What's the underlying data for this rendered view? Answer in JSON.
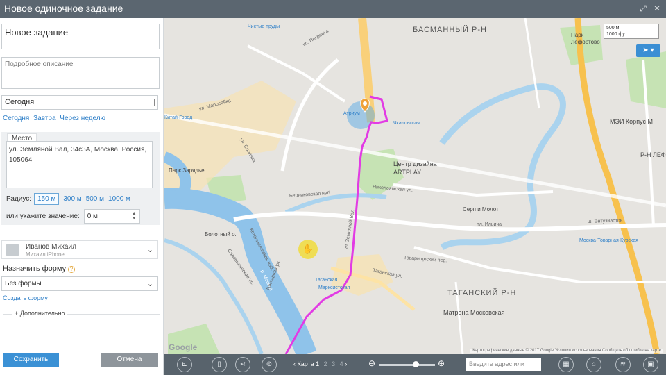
{
  "window": {
    "title": "Новое одиночное задание"
  },
  "form": {
    "title_value": "Новое задание",
    "description_placeholder": "Подробное описание",
    "date_value": "Сегодня",
    "date_links": [
      "Сегодня",
      "Завтра",
      "Через неделю"
    ],
    "place_legend": "Место",
    "address_value": "ул. Земляной Вал, 34с3А, Москва, Россия, 105064",
    "radius_label": "Радиус:",
    "radius_options": [
      "150 м",
      "300 м",
      "500 м",
      "1000 м"
    ],
    "radius_selected": "150 м",
    "or_label": "или укажите значение:",
    "or_value": "0 м",
    "user_name": "Иванов Михаил",
    "user_device": "Михаил iPhone",
    "assign_form_label": "Назначить форму",
    "form_select_value": "Без формы",
    "create_form_link": "Создать форму",
    "more_label": "Дополнительно",
    "save_label": "Сохранить",
    "cancel_label": "Отмена"
  },
  "map": {
    "districts": [
      "БАСМАННЫЙ Р-Н",
      "ТАГАНСКИЙ Р-Н"
    ],
    "places": {
      "artplay": "Центр дизайна ARTPLAY",
      "chkalovskaya": "Чкаловская",
      "atrium": "Атриум",
      "serp": "Серп и Молот",
      "mei": "МЭИ Корпус М",
      "park": "Парк Лефортово",
      "bolotny": "Болотный о.",
      "taganskaya": "Таганская",
      "marksistskaya": "Марксистская",
      "matrona": "Матрона Московская",
      "tovarnaya": "Москва-Товарная-Курская",
      "chistye": "Чистые пруды",
      "kitay": "Китай-Город",
      "zaryadye": "Парк Зарядье",
      "rn_short": "Р-Н ЛЕФ",
      "river": "р. Москва"
    },
    "roads": {
      "nikoloyamskaya": "Николоямская ул.",
      "berezhkovskaya": "Берниковская наб.",
      "kotelnicheskaya": "Котельническая наб.",
      "zemlyanoy": "ул. Земляной Вал",
      "sadovnicheskaya": "Садовническая ул.",
      "taganskaya_ul": "Таганская ул.",
      "pokrovka": "ул. Покровка",
      "maroseyka": "ул. Маросейка",
      "solyanka": "ул. Солянка",
      "entuziastov": "ш. Энтузиастов",
      "goncharnaya": "Гончарная ул.",
      "tovarishcheskiy": "Товарищеский пер.",
      "ilyicha": "пл. Ильича"
    },
    "scale": [
      "500 м",
      "1000 фут"
    ],
    "google": "Google",
    "attribution": "Картографические данные © 2017 Google   Условия использования   Сообщить об ошибке на карте"
  },
  "toolbar": {
    "map_label": "Карта 1",
    "pages": [
      "2",
      "3",
      "4"
    ],
    "search_placeholder": "Введите адрес или"
  },
  "colors": {
    "accent": "#3b91d5",
    "route": "#e23be4",
    "titlebar": "#5b6670"
  }
}
